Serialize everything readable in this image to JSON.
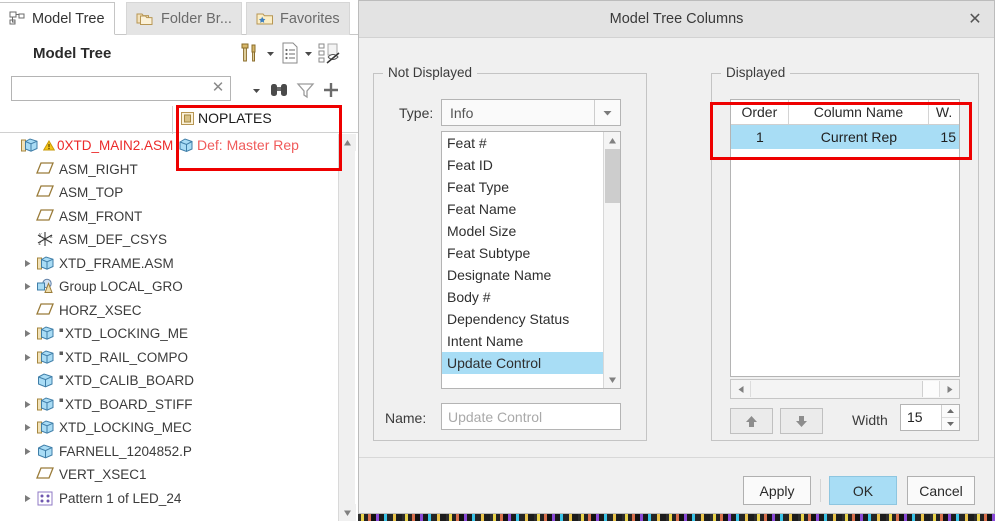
{
  "left_panel": {
    "tabs": [
      {
        "label": "Model Tree",
        "icon": "model-tree-icon",
        "active": true
      },
      {
        "label": "Folder Br...",
        "icon": "folder-browser-icon",
        "active": false
      },
      {
        "label": "Favorites",
        "icon": "favorites-folder-icon",
        "active": false
      }
    ],
    "panel_title": "Model Tree",
    "toolbar_top": [
      "settings-tools-icon",
      "chevron-down-icon",
      "show-list-icon",
      "chevron-down-icon",
      "tree-filter-off-icon"
    ],
    "toolbar_bottom": [
      "chevron-down-icon",
      "binoculars-search-icon",
      "funnel-filter-icon",
      "plus-icon"
    ],
    "search": {
      "value": "",
      "placeholder": ""
    },
    "column_header": "NOPLATES",
    "rep_cell": "Def: Master Rep",
    "tree_items": [
      {
        "label": "0XTD_MAIN2.ASM",
        "icon": "assembly-icon",
        "indent": 0,
        "expander": false,
        "warning": true,
        "red": true
      },
      {
        "label": "ASM_RIGHT",
        "icon": "datum-plane-icon",
        "indent": 1,
        "expander": false,
        "warning": false,
        "red": false
      },
      {
        "label": "ASM_TOP",
        "icon": "datum-plane-icon",
        "indent": 1,
        "expander": false,
        "warning": false,
        "red": false
      },
      {
        "label": "ASM_FRONT",
        "icon": "datum-plane-icon",
        "indent": 1,
        "expander": false,
        "warning": false,
        "red": false
      },
      {
        "label": "ASM_DEF_CSYS",
        "icon": "coordinate-system-icon",
        "indent": 1,
        "expander": false,
        "warning": false,
        "red": false
      },
      {
        "label": "XTD_FRAME.ASM",
        "icon": "assembly-icon",
        "indent": 1,
        "expander": true,
        "warning": false,
        "red": false
      },
      {
        "label": "Group LOCAL_GRO",
        "icon": "group-icon",
        "indent": 1,
        "expander": true,
        "warning": false,
        "red": false
      },
      {
        "label": "HORZ_XSEC",
        "icon": "datum-plane-icon",
        "indent": 1,
        "expander": false,
        "warning": false,
        "red": false
      },
      {
        "label": "XTD_LOCKING_ME",
        "icon": "assembly-icon",
        "indent": 1,
        "expander": true,
        "warning": false,
        "red": false,
        "prefix_mark": true
      },
      {
        "label": "XTD_RAIL_COMPO",
        "icon": "assembly-icon",
        "indent": 1,
        "expander": true,
        "warning": false,
        "red": false,
        "prefix_mark": true
      },
      {
        "label": "XTD_CALIB_BOARD",
        "icon": "part-icon",
        "indent": 1,
        "expander": false,
        "warning": false,
        "red": false,
        "prefix_mark": true
      },
      {
        "label": "XTD_BOARD_STIFF",
        "icon": "assembly-icon",
        "indent": 1,
        "expander": true,
        "warning": false,
        "red": false,
        "prefix_mark": true
      },
      {
        "label": "XTD_LOCKING_MEC",
        "icon": "assembly-icon",
        "indent": 1,
        "expander": true,
        "warning": false,
        "red": false
      },
      {
        "label": "FARNELL_1204852.P",
        "icon": "part-icon",
        "indent": 1,
        "expander": true,
        "warning": false,
        "red": false
      },
      {
        "label": "VERT_XSEC1",
        "icon": "datum-plane-icon",
        "indent": 1,
        "expander": false,
        "warning": false,
        "red": false
      },
      {
        "label": "Pattern 1 of LED_24",
        "icon": "pattern-icon",
        "indent": 1,
        "expander": true,
        "warning": false,
        "red": false
      }
    ]
  },
  "dialog": {
    "title": "Model Tree Columns",
    "close_icon": "close-icon",
    "not_displayed": {
      "legend": "Not Displayed",
      "type_label": "Type:",
      "type_value": "Info",
      "list_items": [
        "Feat #",
        "Feat ID",
        "Feat Type",
        "Feat Name",
        "Model Size",
        "Feat Subtype",
        "Designate Name",
        "Body #",
        "Dependency Status",
        "Intent Name",
        "Update Control"
      ],
      "selected_item": "Update Control",
      "name_label": "Name:",
      "name_value": "Update Control"
    },
    "transfer": {
      "add_label": ">>",
      "remove_label": "<<"
    },
    "displayed": {
      "legend": "Displayed",
      "columns": [
        "Order",
        "Column Name",
        "W."
      ],
      "rows": [
        {
          "order": "1",
          "name": "Current Rep",
          "width": "15"
        }
      ],
      "move_up_icon": "arrow-up-icon",
      "move_down_icon": "arrow-down-icon",
      "width_label": "Width",
      "width_value": "15"
    },
    "buttons": {
      "apply": "Apply",
      "ok": "OK",
      "cancel": "Cancel"
    }
  },
  "colors": {
    "selection_blue": "#a8ddf5",
    "annotation_red": "#ee0000",
    "tree_red_text": "#ec2a2a",
    "dialog_bg": "#f0f0f0"
  }
}
